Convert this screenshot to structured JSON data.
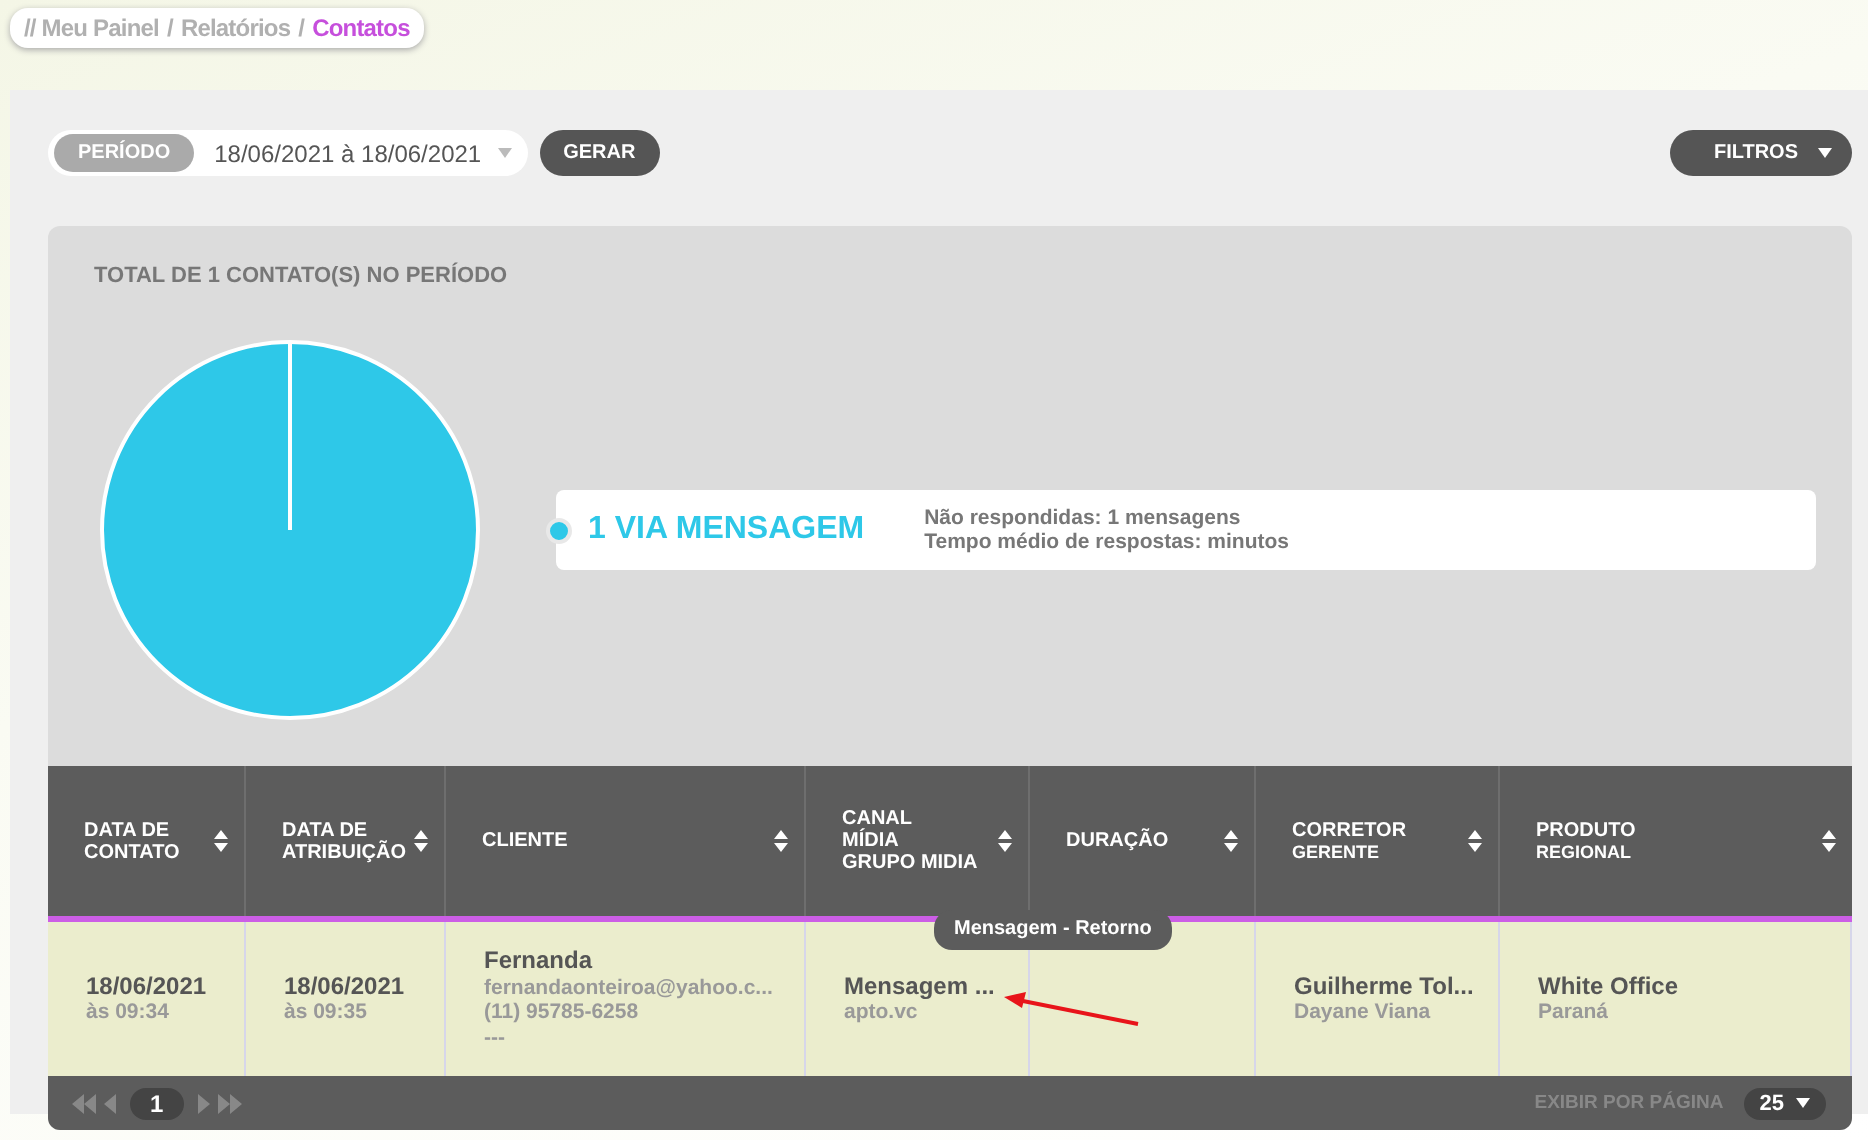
{
  "breadcrumb": [
    {
      "label": "// Meu Painel",
      "current": false
    },
    {
      "label": "Relatórios",
      "current": false
    },
    {
      "label": "Contatos",
      "current": true
    }
  ],
  "breadcrumb_separator": "/",
  "toolbar": {
    "period_label": "PERÍODO",
    "period_value": "18/06/2021 à 18/06/2021",
    "generate": "GERAR",
    "filters": "FILTROS"
  },
  "summary": {
    "title": "TOTAL DE 1 CONTATO(S) NO PERÍODO",
    "legend": {
      "label": "1 VIA MENSAGEM",
      "color": "#2ec8e8",
      "details": [
        "Não respondidas: 1 mensagens",
        "Tempo médio de respostas: minutos"
      ]
    }
  },
  "table": {
    "columns": [
      {
        "lines": [
          "DATA DE",
          "CONTATO"
        ]
      },
      {
        "lines": [
          "DATA DE",
          "ATRIBUIÇÃO"
        ]
      },
      {
        "lines": [
          "CLIENTE"
        ]
      },
      {
        "lines": [
          "CANAL",
          "MÍDIA",
          "GRUPO MIDIA"
        ]
      },
      {
        "lines": [
          "DURAÇÃO"
        ]
      },
      {
        "lines": [
          "CORRETOR"
        ],
        "sub": "GERENTE"
      },
      {
        "lines": [
          "PRODUTO"
        ],
        "sub": "REGIONAL"
      }
    ],
    "rows": [
      {
        "cells": [
          {
            "main": "18/06/2021",
            "details": [
              "às 09:34"
            ]
          },
          {
            "main": "18/06/2021",
            "details": [
              "às 09:35"
            ]
          },
          {
            "main": "Fernanda",
            "details": [
              "fernandaonteiroa@yahoo.c...",
              "(11) 95785-6258",
              "---"
            ]
          },
          {
            "main": "Mensagem ...",
            "details": [
              "apto.vc"
            ],
            "tooltip": "Mensagem - Retorno"
          },
          {},
          {
            "main": "Guilherme Tol...",
            "details": [
              "Dayane Viana"
            ]
          },
          {
            "main": "White Office",
            "details": [
              "Paraná"
            ]
          }
        ]
      }
    ]
  },
  "pagination": {
    "current": "1",
    "per_page_label": "EXIBIR POR PÁGINA",
    "per_page": "25"
  }
}
